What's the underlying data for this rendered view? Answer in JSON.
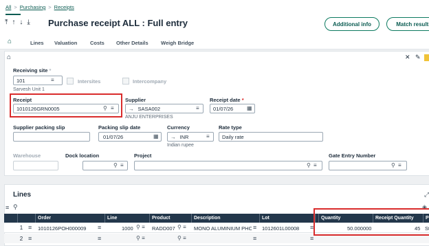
{
  "breadcrumb": {
    "items": [
      "All",
      "Purchasing",
      "Receipts"
    ]
  },
  "page": {
    "title": "Purchase receipt ALL : Full entry"
  },
  "actions": {
    "additional_info": "Additional info",
    "match_results": "Match results"
  },
  "tabs": [
    "Lines",
    "Valuation",
    "Costs",
    "Other Details",
    "Weigh Bridge"
  ],
  "form": {
    "receiving_site": {
      "label": "Receiving site",
      "value": "101",
      "sub": "Sarvesh Unit 1"
    },
    "intersites": "Intersites",
    "intercompany": "Intercompany",
    "receipt": {
      "label": "Receipt",
      "value": "1010126GRN0005"
    },
    "supplier": {
      "label": "Supplier",
      "value": "SASA002",
      "sub": "ANJU ENTERPRISES"
    },
    "receipt_date": {
      "label": "Receipt date",
      "value": "01/07/26"
    },
    "supplier_packing_slip": {
      "label": "Supplier packing slip",
      "value": ""
    },
    "packing_slip_date": {
      "label": "Packing slip date",
      "value": "01/07/26"
    },
    "currency": {
      "label": "Currency",
      "value": "INR",
      "sub": "Indian rupee"
    },
    "rate_type": {
      "label": "Rate type",
      "value": "Daily rate"
    },
    "warehouse": {
      "label": "Warehouse"
    },
    "dock_location": {
      "label": "Dock location"
    },
    "project": {
      "label": "Project"
    },
    "gate_entry": {
      "label": "Gate Entry Number"
    }
  },
  "lines": {
    "title": "Lines",
    "columns": [
      "Order",
      "Line",
      "Product",
      "Description",
      "Lot",
      "Quantity",
      "Receipt Quantity",
      "Pr"
    ],
    "rows": [
      {
        "num": "1",
        "order": "1010126POH000009",
        "line": "1000",
        "product": "RADD007",
        "description": "MONO ALUMINIUM PHOS",
        "lot": "1012601L00008",
        "quantity": "50.000000",
        "receipt_qty": "45",
        "extra": "St"
      },
      {
        "num": "2",
        "order": "",
        "line": "",
        "product": "",
        "description": "",
        "lot": "",
        "quantity": "",
        "receipt_qty": "",
        "extra": ""
      }
    ]
  },
  "colors": {
    "accent": "#0b5c52",
    "header": "#23374b",
    "highlight": "#d92b2b"
  }
}
